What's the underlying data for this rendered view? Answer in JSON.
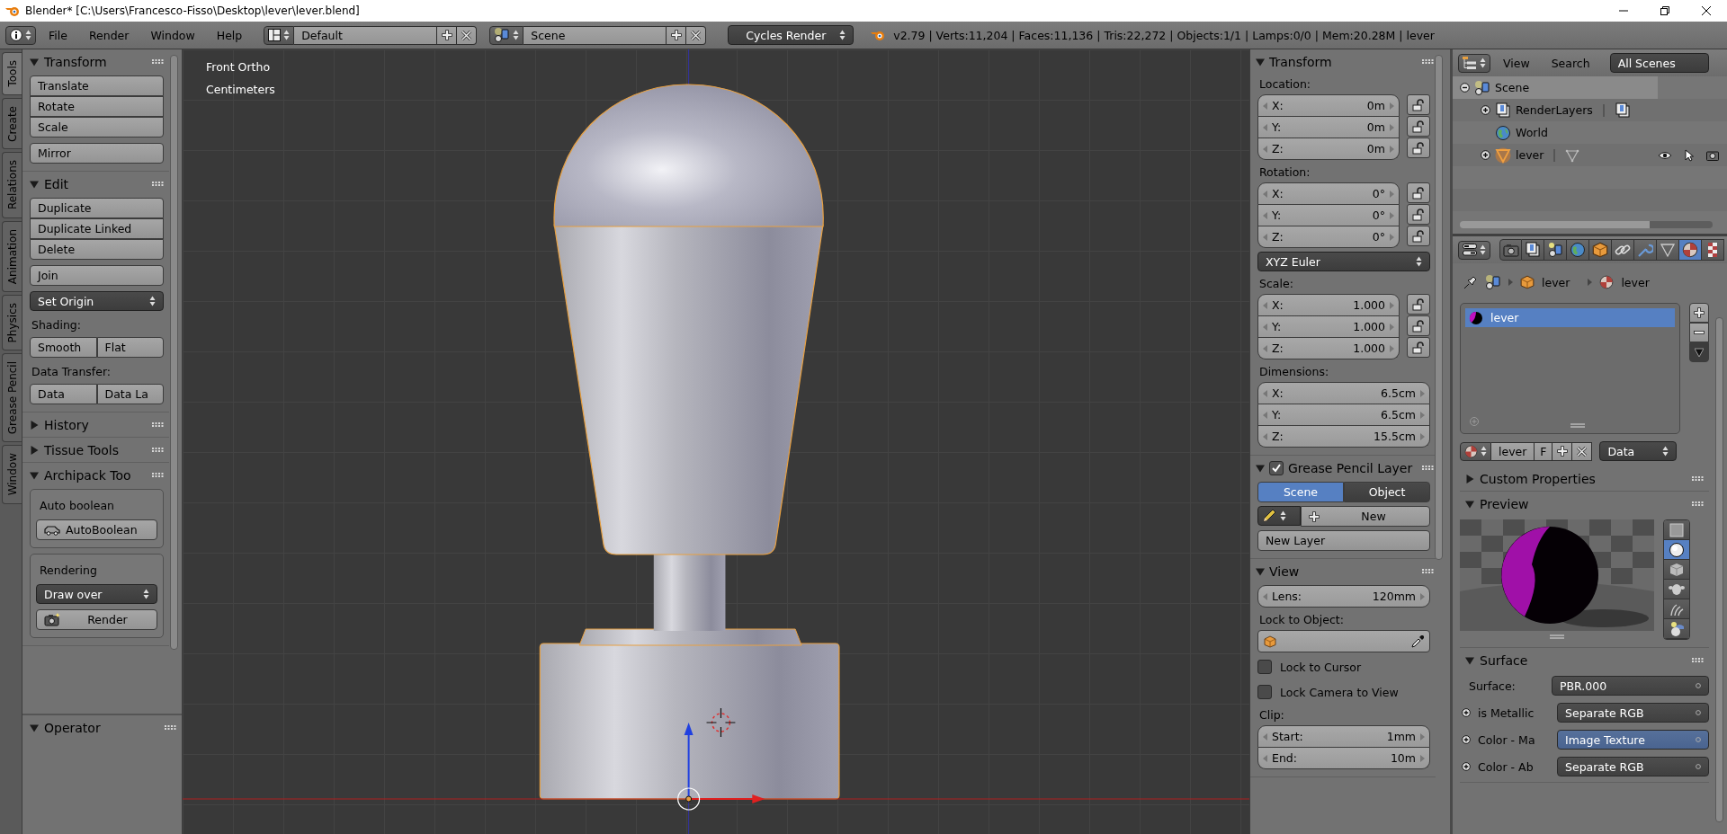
{
  "title_bar": {
    "title": "Blender* [C:\\Users\\Francesco-Fisso\\Desktop\\lever\\lever.blend]"
  },
  "info_header": {
    "menus": [
      "File",
      "Render",
      "Window",
      "Help"
    ],
    "screen_layout": "Default",
    "scene": "Scene",
    "render_engine": "Cycles Render",
    "stats": "v2.79 | Verts:11,204 | Faces:11,136 | Tris:22,272 | Objects:1/1 | Lamps:0/0 | Mem:20.28M | lever"
  },
  "tool_shelf": {
    "tabs": [
      {
        "label": "Tools",
        "selected": true
      },
      {
        "label": "Create",
        "selected": false
      },
      {
        "label": "Relations",
        "selected": false
      },
      {
        "label": "Animation",
        "selected": false
      },
      {
        "label": "Physics",
        "selected": false
      },
      {
        "label": "Grease Pencil",
        "selected": false
      },
      {
        "label": "Window",
        "selected": false
      }
    ],
    "panels": [
      {
        "title": "Transform",
        "expanded": true,
        "items": [
          {
            "kind": "column",
            "buttons": [
              "Translate",
              "Rotate",
              "Scale"
            ]
          },
          {
            "kind": "button",
            "label": "Mirror"
          }
        ]
      },
      {
        "title": "Edit",
        "expanded": true,
        "items": [
          {
            "kind": "column",
            "buttons": [
              "Duplicate",
              "Duplicate Linked",
              "Delete"
            ]
          },
          {
            "kind": "button",
            "label": "Join"
          },
          {
            "kind": "dropdown",
            "value": "Set Origin"
          },
          {
            "kind": "label",
            "text": "Shading:"
          },
          {
            "kind": "row",
            "buttons": [
              "Smooth",
              "Flat"
            ]
          },
          {
            "kind": "label",
            "text": "Data Transfer:"
          },
          {
            "kind": "row",
            "buttons": [
              "Data",
              "Data La"
            ]
          }
        ]
      },
      {
        "title": "History",
        "expanded": false
      },
      {
        "title": "Tissue Tools",
        "expanded": false
      },
      {
        "title": "Archipack Too",
        "expanded": true,
        "items": [
          {
            "kind": "box",
            "items": [
              {
                "kind": "label",
                "text": "Auto boolean"
              },
              {
                "kind": "car-button",
                "label": "AutoBoolean"
              }
            ]
          },
          {
            "kind": "box",
            "items": [
              {
                "kind": "label",
                "text": "Rendering"
              },
              {
                "kind": "dropdown",
                "value": "Draw over"
              },
              {
                "kind": "camera-button",
                "label": "Render"
              }
            ]
          }
        ]
      }
    ],
    "operator": {
      "title": "Operator",
      "expanded": true
    }
  },
  "viewport": {
    "view_name": "Front Ortho",
    "units": "Centimeters"
  },
  "properties_region": {
    "panels": [
      {
        "title": "Transform",
        "expanded": true,
        "items": [
          {
            "kind": "label",
            "text": "Location:"
          },
          {
            "kind": "locked-vector",
            "fields": [
              {
                "axis": "X:",
                "value": "0m"
              },
              {
                "axis": "Y:",
                "value": "0m"
              },
              {
                "axis": "Z:",
                "value": "0m"
              }
            ]
          },
          {
            "kind": "label",
            "text": "Rotation:"
          },
          {
            "kind": "locked-vector",
            "fields": [
              {
                "axis": "X:",
                "value": "0°"
              },
              {
                "axis": "Y:",
                "value": "0°"
              },
              {
                "axis": "Z:",
                "value": "0°"
              }
            ]
          },
          {
            "kind": "dropdown",
            "value": "XYZ Euler"
          },
          {
            "kind": "label",
            "text": "Scale:"
          },
          {
            "kind": "locked-vector",
            "fields": [
              {
                "axis": "X:",
                "value": "1.000"
              },
              {
                "axis": "Y:",
                "value": "1.000"
              },
              {
                "axis": "Z:",
                "value": "1.000"
              }
            ]
          },
          {
            "kind": "label",
            "text": "Dimensions:"
          },
          {
            "kind": "vector",
            "fields": [
              {
                "axis": "X:",
                "value": "6.5cm"
              },
              {
                "axis": "Y:",
                "value": "6.5cm"
              },
              {
                "axis": "Z:",
                "value": "15.5cm"
              }
            ]
          }
        ]
      },
      {
        "title": "Grease Pencil Layer",
        "expanded": true,
        "checked": true,
        "items": [
          {
            "kind": "segmented",
            "options": [
              {
                "label": "Scene",
                "selected": true
              },
              {
                "label": "Object",
                "selected": false
              }
            ]
          },
          {
            "kind": "new-row",
            "label": "New"
          },
          {
            "kind": "button",
            "label": "New Layer"
          }
        ]
      },
      {
        "title": "View",
        "expanded": true,
        "items": [
          {
            "kind": "vector",
            "fields": [
              {
                "axis": "Lens:",
                "value": "120mm"
              }
            ]
          },
          {
            "kind": "label",
            "text": "Lock to Object:"
          },
          {
            "kind": "object-field"
          },
          {
            "kind": "checkbox",
            "label": "Lock to Cursor",
            "checked": false
          },
          {
            "kind": "checkbox",
            "label": "Lock Camera to View",
            "checked": false
          },
          {
            "kind": "label",
            "text": "Clip:"
          },
          {
            "kind": "vector",
            "fields": [
              {
                "axis": "Start:",
                "value": "1mm"
              },
              {
                "axis": "End:",
                "value": "10m"
              }
            ]
          }
        ]
      }
    ]
  },
  "outliner": {
    "menus": [
      "View",
      "Search"
    ],
    "filter": "All Scenes",
    "tree": [
      {
        "name": "Scene",
        "kind": "scene",
        "expanded": true,
        "selected": true,
        "children": [
          {
            "name": "RenderLayers",
            "kind": "render-layers",
            "expanded": false,
            "selected": false
          },
          {
            "name": "World",
            "kind": "world",
            "selected": false
          },
          {
            "name": "lever",
            "kind": "mesh-object",
            "expanded": false,
            "selected": false
          }
        ]
      }
    ]
  },
  "properties_editor": {
    "context_tabs": [
      {
        "kind": "render",
        "selected": false
      },
      {
        "kind": "render-layers",
        "selected": false
      },
      {
        "kind": "scene",
        "selected": false
      },
      {
        "kind": "world",
        "selected": false
      },
      {
        "kind": "object",
        "selected": false
      },
      {
        "kind": "constraints",
        "selected": false
      },
      {
        "kind": "modifiers",
        "selected": false
      },
      {
        "kind": "data",
        "selected": false
      },
      {
        "kind": "material",
        "selected": true
      },
      {
        "kind": "texture",
        "selected": false
      }
    ],
    "breadcrumb": [
      "lever",
      "lever"
    ],
    "material_slots": [
      {
        "name": "lever",
        "selected": true
      }
    ],
    "material_datablock": {
      "name": "lever",
      "fake_user": "F",
      "link": "Data"
    },
    "panels": [
      {
        "title": "Custom Properties",
        "expanded": false
      },
      {
        "title": "Preview",
        "expanded": true,
        "kind": "preview",
        "preview_types": [
          {
            "kind": "flat",
            "selected": false
          },
          {
            "kind": "sphere",
            "selected": true
          },
          {
            "kind": "cube",
            "selected": false
          },
          {
            "kind": "monkey",
            "selected": false
          },
          {
            "kind": "hair",
            "selected": false
          },
          {
            "kind": "sky",
            "selected": false
          }
        ]
      },
      {
        "title": "Surface",
        "expanded": true,
        "kind": "surface",
        "surface": {
          "label": "Surface:",
          "value": "PBR.000"
        },
        "inputs": [
          {
            "label": "is Metallic",
            "value": "Separate RGB",
            "selected": false
          },
          {
            "label": "Color - Ma",
            "value": "Image Texture",
            "selected": true
          },
          {
            "label": "Color - Ab",
            "value": "Separate RGB",
            "selected": false
          }
        ]
      }
    ]
  }
}
